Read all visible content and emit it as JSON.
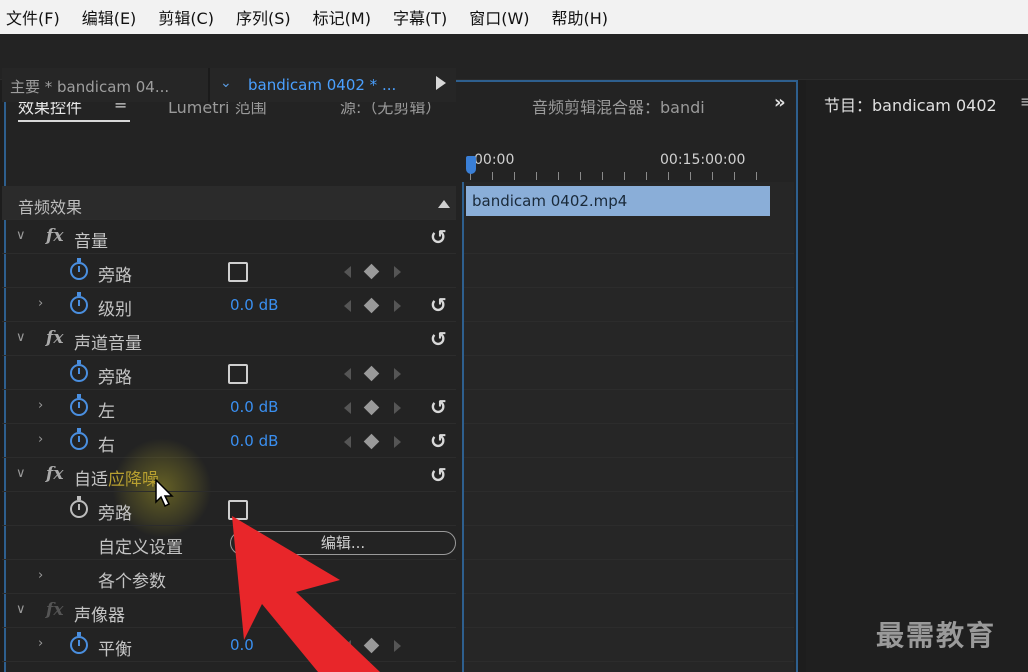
{
  "menu": [
    "文件(F)",
    "编辑(E)",
    "剪辑(C)",
    "序列(S)",
    "标记(M)",
    "字幕(T)",
    "窗口(W)",
    "帮助(H)"
  ],
  "panel": {
    "tabs": {
      "effect_controls": "效果控件",
      "menu": "≡",
      "lumetri": "Lumetri 范围",
      "source": "源:（无剪辑）",
      "audio_mixer": "音频剪辑混合器：bandi",
      "overflow": "»"
    },
    "clip_header": {
      "master": "主要 * bandicam 04...",
      "sequence": "bandicam 0402 * ..."
    },
    "section_label": "音频效果",
    "effects": {
      "volume": {
        "name": "音量",
        "bypass": "旁路",
        "level_label": "级别",
        "level_value": "0.0 dB"
      },
      "channel_volume": {
        "name": "声道音量",
        "bypass": "旁路",
        "left_label": "左",
        "left_value": "0.0 dB",
        "right_label": "右",
        "right_value": "0.0 dB"
      },
      "adaptive_noise": {
        "name_a": "自适",
        "name_b": "应降噪",
        "bypass": "旁路",
        "custom_setup": "自定义设置",
        "edit_button": "编辑...",
        "params": "各个参数"
      },
      "panner": {
        "name": "声像器",
        "balance_label": "平衡",
        "balance_value": "0.0"
      }
    },
    "timeline": {
      "start": "00:00",
      "end": "00:15:00:00",
      "clip_name": "bandicam 0402.mp4"
    }
  },
  "program": {
    "title": "节目：bandicam 0402",
    "menu": "≡"
  },
  "watermark": "最需教育",
  "colors": {
    "accent_blue": "#3a8ff0",
    "panel_border": "#2e5f8e",
    "annotation_red": "#e8262a",
    "clip_bar": "#8aaed8"
  }
}
